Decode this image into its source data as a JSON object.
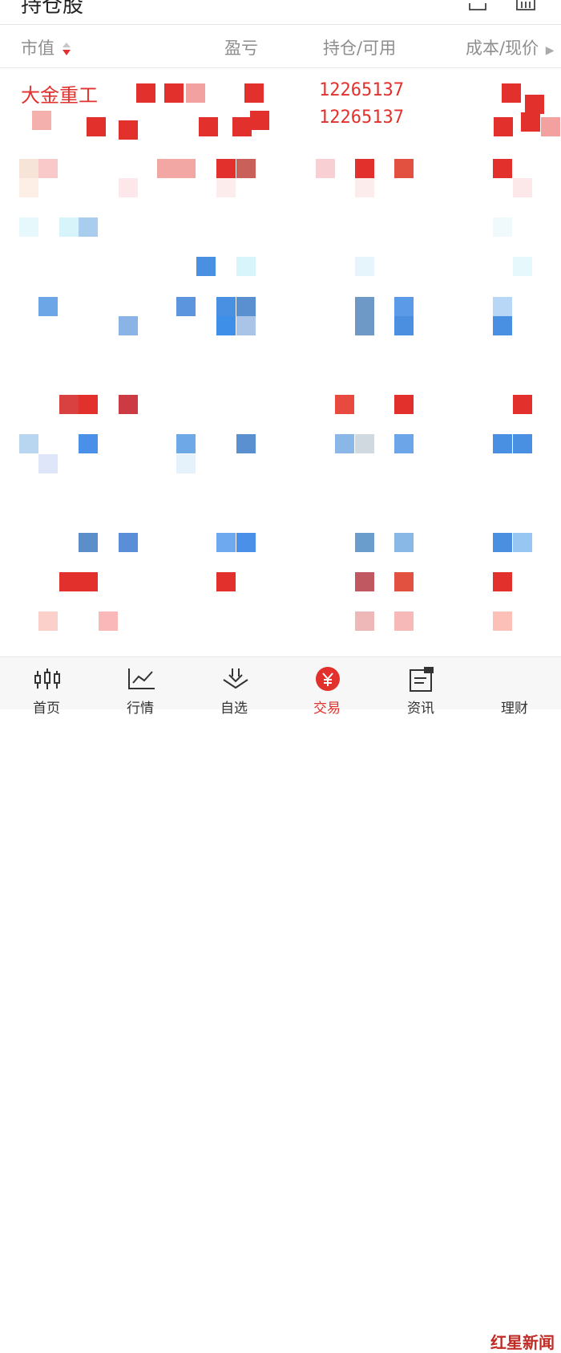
{
  "header": {
    "title": "持仓股"
  },
  "columns": {
    "market_value": "市值",
    "profit": "盈亏",
    "position": "持仓/可用",
    "cost": "成本/现价"
  },
  "holding": {
    "name": "大金重工",
    "position": "12265137",
    "available": "12265137"
  },
  "tabs": [
    {
      "label": "首页",
      "icon": "candlestick-icon"
    },
    {
      "label": "行情",
      "icon": "line-chart-icon"
    },
    {
      "label": "自选",
      "icon": "watchlist-icon"
    },
    {
      "label": "交易",
      "icon": "trade-yuan-icon",
      "active": true
    },
    {
      "label": "资讯",
      "icon": "news-icon"
    },
    {
      "label": "理财",
      "icon": "wealth-icon"
    }
  ],
  "watermark": {
    "text": "红星新闻"
  },
  "colors": {
    "accent": "#e2312d",
    "muted_text": "#8e8e8e",
    "blue_mosaic": "#4a90e2"
  }
}
